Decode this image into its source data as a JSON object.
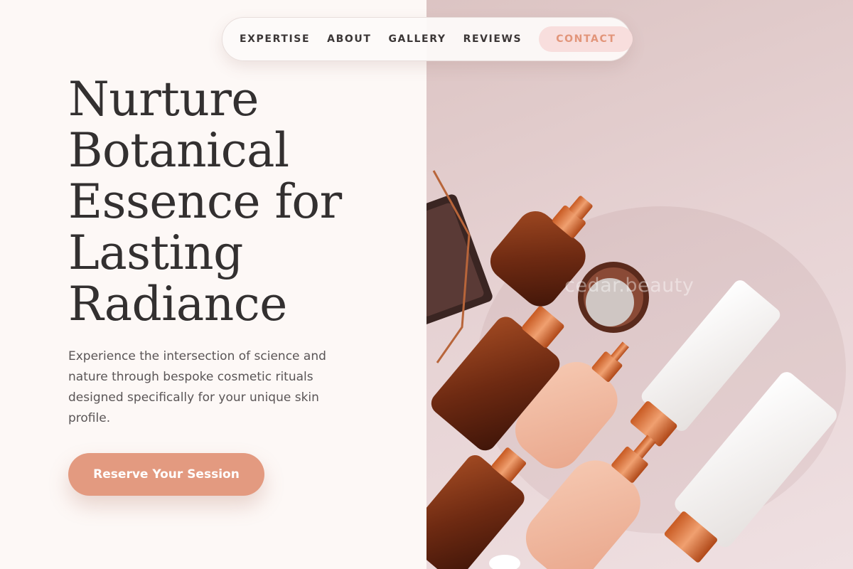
{
  "nav": {
    "links": [
      "EXPERTISE",
      "ABOUT",
      "GALLERY",
      "REVIEWS"
    ],
    "contact_label": "CONTACT"
  },
  "hero": {
    "title_lines": [
      "Nurture",
      "Botanical",
      "Essence for",
      "Lasting",
      "Radiance"
    ],
    "description": "Experience the intersection of science and nature through bespoke cosmetic rituals designed specifically for your unique skin profile.",
    "cta_label": "Reserve Your Session"
  },
  "photo": {
    "watermark": "cedar.beauty",
    "subject": "cosmetic-bottles-flatlay"
  },
  "colors": {
    "accent": "#e39a80",
    "contact_bg": "#f8dedd",
    "contact_text": "#e2957a",
    "page_bg": "#fdf8f6",
    "heading": "#333030",
    "body_text": "#5a5556"
  }
}
